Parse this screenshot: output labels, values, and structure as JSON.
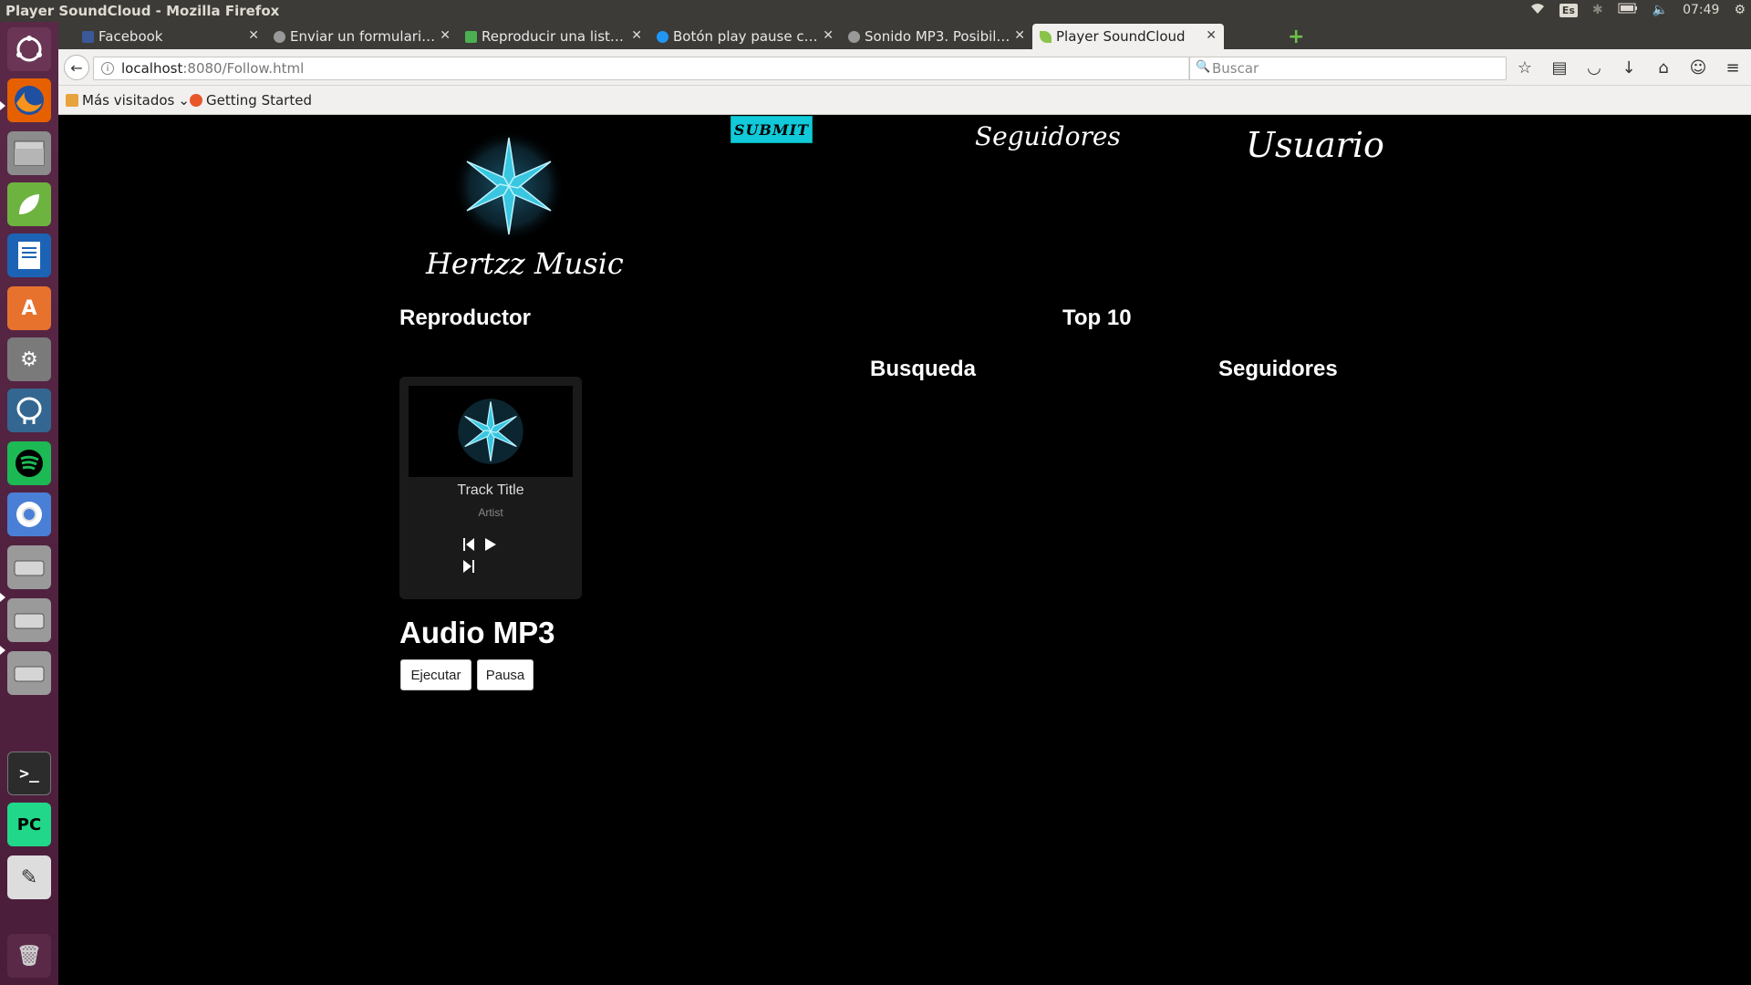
{
  "os_panel": {
    "window_title": "Player SoundCloud - Mozilla Firefox",
    "language": "Es",
    "clock": "07:49"
  },
  "tabs": [
    {
      "label": "Facebook",
      "favicon_color": "#3b5998"
    },
    {
      "label": "Enviar un formulari…",
      "favicon_color": "#999999"
    },
    {
      "label": "Reproducir una list…",
      "favicon_color": "#4caf50"
    },
    {
      "label": "Botón play pause c…",
      "favicon_color": "#2196f3"
    },
    {
      "label": "Sonido MP3. Posibil…",
      "favicon_color": "#999999"
    },
    {
      "label": "Player SoundCloud",
      "favicon_color": "#8bc34a"
    }
  ],
  "url": {
    "host": "localhost",
    "path": ":8080/Follow.html"
  },
  "search": {
    "placeholder": "Buscar"
  },
  "bookmarks": [
    {
      "label": "Más visitados",
      "icon_color": "#e8a33d"
    },
    {
      "label": "Getting Started",
      "icon_color": "#e8562a"
    }
  ],
  "page": {
    "submit_label": "SUBMIT",
    "nav_seguidores": "Seguidores",
    "nav_usuario": "Usuario",
    "brand": "Hertzz Music",
    "heading_reproductor": "Reproductor",
    "heading_top10": "Top 10",
    "heading_busqueda": "Busqueda",
    "heading_seguidores": "Seguidores",
    "player": {
      "track_title": "Track Title",
      "artist": "Artist"
    },
    "heading_audio": "Audio MP3",
    "btn_play": "Ejecutar",
    "btn_pause": "Pausa"
  },
  "colors": {
    "accent": "#11c9d8",
    "star": "#38c6e0"
  }
}
